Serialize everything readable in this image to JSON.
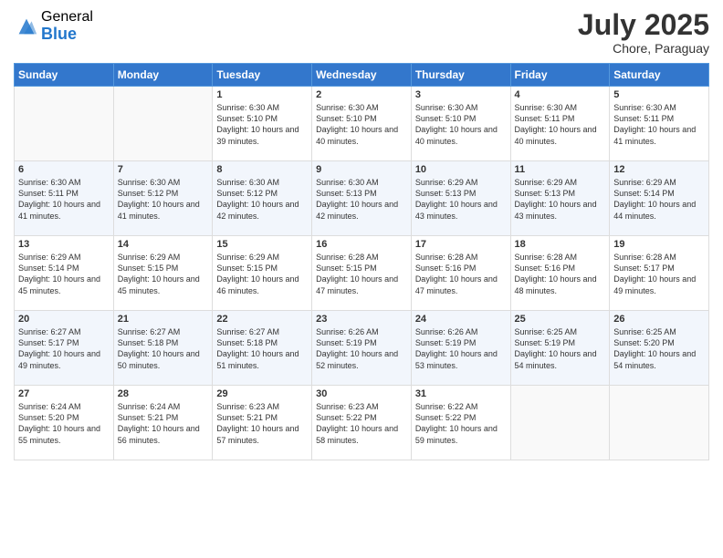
{
  "logo": {
    "general": "General",
    "blue": "Blue"
  },
  "title": "July 2025",
  "location": "Chore, Paraguay",
  "days_of_week": [
    "Sunday",
    "Monday",
    "Tuesday",
    "Wednesday",
    "Thursday",
    "Friday",
    "Saturday"
  ],
  "weeks": [
    {
      "days": [
        {
          "num": "",
          "empty": true
        },
        {
          "num": "",
          "empty": true
        },
        {
          "num": "1",
          "sunrise": "6:30 AM",
          "sunset": "5:10 PM",
          "daylight": "10 hours and 39 minutes."
        },
        {
          "num": "2",
          "sunrise": "6:30 AM",
          "sunset": "5:10 PM",
          "daylight": "10 hours and 40 minutes."
        },
        {
          "num": "3",
          "sunrise": "6:30 AM",
          "sunset": "5:10 PM",
          "daylight": "10 hours and 40 minutes."
        },
        {
          "num": "4",
          "sunrise": "6:30 AM",
          "sunset": "5:11 PM",
          "daylight": "10 hours and 40 minutes."
        },
        {
          "num": "5",
          "sunrise": "6:30 AM",
          "sunset": "5:11 PM",
          "daylight": "10 hours and 41 minutes."
        }
      ]
    },
    {
      "days": [
        {
          "num": "6",
          "sunrise": "6:30 AM",
          "sunset": "5:11 PM",
          "daylight": "10 hours and 41 minutes."
        },
        {
          "num": "7",
          "sunrise": "6:30 AM",
          "sunset": "5:12 PM",
          "daylight": "10 hours and 41 minutes."
        },
        {
          "num": "8",
          "sunrise": "6:30 AM",
          "sunset": "5:12 PM",
          "daylight": "10 hours and 42 minutes."
        },
        {
          "num": "9",
          "sunrise": "6:30 AM",
          "sunset": "5:13 PM",
          "daylight": "10 hours and 42 minutes."
        },
        {
          "num": "10",
          "sunrise": "6:29 AM",
          "sunset": "5:13 PM",
          "daylight": "10 hours and 43 minutes."
        },
        {
          "num": "11",
          "sunrise": "6:29 AM",
          "sunset": "5:13 PM",
          "daylight": "10 hours and 43 minutes."
        },
        {
          "num": "12",
          "sunrise": "6:29 AM",
          "sunset": "5:14 PM",
          "daylight": "10 hours and 44 minutes."
        }
      ]
    },
    {
      "days": [
        {
          "num": "13",
          "sunrise": "6:29 AM",
          "sunset": "5:14 PM",
          "daylight": "10 hours and 45 minutes."
        },
        {
          "num": "14",
          "sunrise": "6:29 AM",
          "sunset": "5:15 PM",
          "daylight": "10 hours and 45 minutes."
        },
        {
          "num": "15",
          "sunrise": "6:29 AM",
          "sunset": "5:15 PM",
          "daylight": "10 hours and 46 minutes."
        },
        {
          "num": "16",
          "sunrise": "6:28 AM",
          "sunset": "5:15 PM",
          "daylight": "10 hours and 47 minutes."
        },
        {
          "num": "17",
          "sunrise": "6:28 AM",
          "sunset": "5:16 PM",
          "daylight": "10 hours and 47 minutes."
        },
        {
          "num": "18",
          "sunrise": "6:28 AM",
          "sunset": "5:16 PM",
          "daylight": "10 hours and 48 minutes."
        },
        {
          "num": "19",
          "sunrise": "6:28 AM",
          "sunset": "5:17 PM",
          "daylight": "10 hours and 49 minutes."
        }
      ]
    },
    {
      "days": [
        {
          "num": "20",
          "sunrise": "6:27 AM",
          "sunset": "5:17 PM",
          "daylight": "10 hours and 49 minutes."
        },
        {
          "num": "21",
          "sunrise": "6:27 AM",
          "sunset": "5:18 PM",
          "daylight": "10 hours and 50 minutes."
        },
        {
          "num": "22",
          "sunrise": "6:27 AM",
          "sunset": "5:18 PM",
          "daylight": "10 hours and 51 minutes."
        },
        {
          "num": "23",
          "sunrise": "6:26 AM",
          "sunset": "5:19 PM",
          "daylight": "10 hours and 52 minutes."
        },
        {
          "num": "24",
          "sunrise": "6:26 AM",
          "sunset": "5:19 PM",
          "daylight": "10 hours and 53 minutes."
        },
        {
          "num": "25",
          "sunrise": "6:25 AM",
          "sunset": "5:19 PM",
          "daylight": "10 hours and 54 minutes."
        },
        {
          "num": "26",
          "sunrise": "6:25 AM",
          "sunset": "5:20 PM",
          "daylight": "10 hours and 54 minutes."
        }
      ]
    },
    {
      "days": [
        {
          "num": "27",
          "sunrise": "6:24 AM",
          "sunset": "5:20 PM",
          "daylight": "10 hours and 55 minutes."
        },
        {
          "num": "28",
          "sunrise": "6:24 AM",
          "sunset": "5:21 PM",
          "daylight": "10 hours and 56 minutes."
        },
        {
          "num": "29",
          "sunrise": "6:23 AM",
          "sunset": "5:21 PM",
          "daylight": "10 hours and 57 minutes."
        },
        {
          "num": "30",
          "sunrise": "6:23 AM",
          "sunset": "5:22 PM",
          "daylight": "10 hours and 58 minutes."
        },
        {
          "num": "31",
          "sunrise": "6:22 AM",
          "sunset": "5:22 PM",
          "daylight": "10 hours and 59 minutes."
        },
        {
          "num": "",
          "empty": true
        },
        {
          "num": "",
          "empty": true
        }
      ]
    }
  ]
}
